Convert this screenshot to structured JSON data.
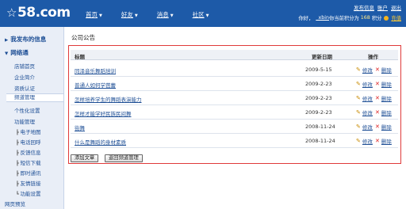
{
  "header": {
    "logo_text": "58.com",
    "logo_mark": "☆",
    "nav": [
      {
        "label": "首页"
      },
      {
        "label": "好友"
      },
      {
        "label": "消息"
      },
      {
        "label": "社区"
      }
    ],
    "top_links": [
      "发布信息",
      "账户",
      "退出"
    ],
    "user_line": {
      "prefix": "你好，",
      "username": "_xbin",
      "middle": " 你当前积分为",
      "score": "168",
      "suffix": "积分",
      "recharge": "充值"
    }
  },
  "sidebar": {
    "sections": [
      {
        "label": "我发布的信息"
      },
      {
        "label": "网络通"
      }
    ],
    "items": [
      "店铺首页",
      "企业简介",
      "资质认证",
      "频道管理",
      "个性化设置",
      "功能管理"
    ],
    "sub_items": [
      "电子地图",
      "电话回呼",
      "反馈信息",
      "短信下载",
      "即时通讯",
      "友情链接",
      "功能设置"
    ],
    "bottom": "网页预览"
  },
  "main": {
    "title": "公司公告",
    "columns": {
      "title": "标题",
      "date": "更新日期",
      "action": "操作"
    },
    "rows": [
      {
        "title": "同泽音乐舞蹈培训",
        "date": "2009-5-15"
      },
      {
        "title": "普通人如何学芭蕾",
        "date": "2009-2-23"
      },
      {
        "title": "怎样培养学生的舞蹈表演能力",
        "date": "2009-2-23"
      },
      {
        "title": "怎样才能学好民族民间舞",
        "date": "2009-2-23"
      },
      {
        "title": "街舞",
        "date": "2008-11-24"
      },
      {
        "title": "什么是舞蹈的身材素质",
        "date": "2008-11-24"
      }
    ],
    "edit_label": "修改",
    "delete_label": "删除",
    "add_button": "添加文章",
    "back_button": "返回频道管理"
  },
  "colors": {
    "header_bg": "#1d5aa8",
    "sidebar_bg": "#e9eef7",
    "link": "#1d4e95",
    "frame": "#e03a3a"
  }
}
